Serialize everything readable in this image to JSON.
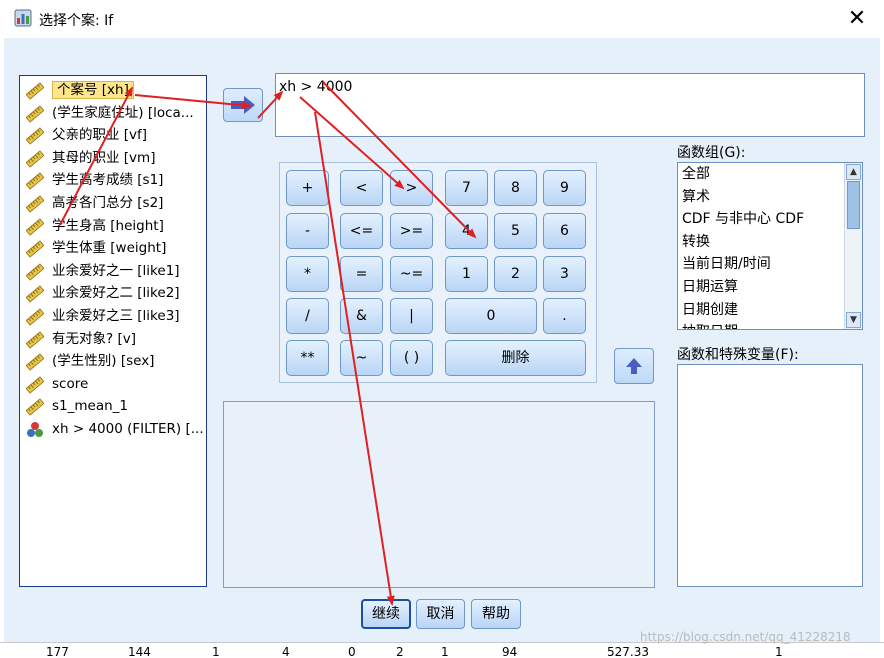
{
  "window": {
    "title": "选择个案: If",
    "close_glyph": "✕"
  },
  "variables": [
    {
      "label": "个案号 [xh]",
      "icon": "ruler-scale-icon",
      "selected": true
    },
    {
      "label": "(学生家庭住址) [loca...",
      "icon": "ruler-scale-icon"
    },
    {
      "label": "父亲的职业 [vf]",
      "icon": "ruler-scale-icon"
    },
    {
      "label": "其母的职业 [vm]",
      "icon": "ruler-scale-icon"
    },
    {
      "label": "学生高考成绩 [s1]",
      "icon": "ruler-scale-icon"
    },
    {
      "label": "高考各门总分 [s2]",
      "icon": "ruler-scale-icon"
    },
    {
      "label": "学生身高 [height]",
      "icon": "ruler-scale-icon"
    },
    {
      "label": "学生体重 [weight]",
      "icon": "ruler-scale-icon"
    },
    {
      "label": "业余爱好之一 [like1]",
      "icon": "ruler-scale-icon"
    },
    {
      "label": "业余爱好之二 [like2]",
      "icon": "ruler-scale-icon"
    },
    {
      "label": "业余爱好之三 [like3]",
      "icon": "ruler-scale-icon"
    },
    {
      "label": "有无对象? [v]",
      "icon": "ruler-scale-icon"
    },
    {
      "label": "(学生性别) [sex]",
      "icon": "ruler-scale-icon"
    },
    {
      "label": "score",
      "icon": "ruler-scale-icon"
    },
    {
      "label": "s1_mean_1",
      "icon": "ruler-scale-icon"
    },
    {
      "label": "xh > 4000 (FILTER) [...",
      "icon": "nominal-balls-icon"
    }
  ],
  "expression": {
    "value": "xh > 4000"
  },
  "keypad": {
    "plus": "+",
    "lt": "<",
    "gt": ">",
    "k7": "7",
    "k8": "8",
    "k9": "9",
    "minus": "-",
    "le": "<=",
    "ge": ">=",
    "k4": "4",
    "k5": "5",
    "k6": "6",
    "mult": "*",
    "eq": "=",
    "ne": "~=",
    "k1": "1",
    "k2": "2",
    "k3": "3",
    "div": "/",
    "and": "&",
    "or": "|",
    "k0": "0",
    "dot": ".",
    "pow": "**",
    "not": "~",
    "paren": "( )",
    "delete": "删除"
  },
  "function_group": {
    "label": "函数组(G):",
    "items": [
      "全部",
      "算术",
      "CDF 与非中心 CDF",
      "转换",
      "当前日期/时间",
      "日期运算",
      "日期创建",
      "抽取日期"
    ]
  },
  "functions": {
    "label": "函数和特殊变量(F):"
  },
  "buttons": {
    "continue": "继续",
    "cancel": "取消",
    "help": "帮助"
  },
  "background_row": [
    "177",
    "144",
    "1",
    "4",
    "0",
    "2",
    "1",
    "94",
    "527.33",
    "1"
  ],
  "watermark": "https://blog.csdn.net/qq_41228218",
  "colors": {
    "dialog_bg": "#e5f0fb",
    "selected_bg": "#ffe68a",
    "annotation": "#e02020",
    "border": "#1c3a8a"
  }
}
